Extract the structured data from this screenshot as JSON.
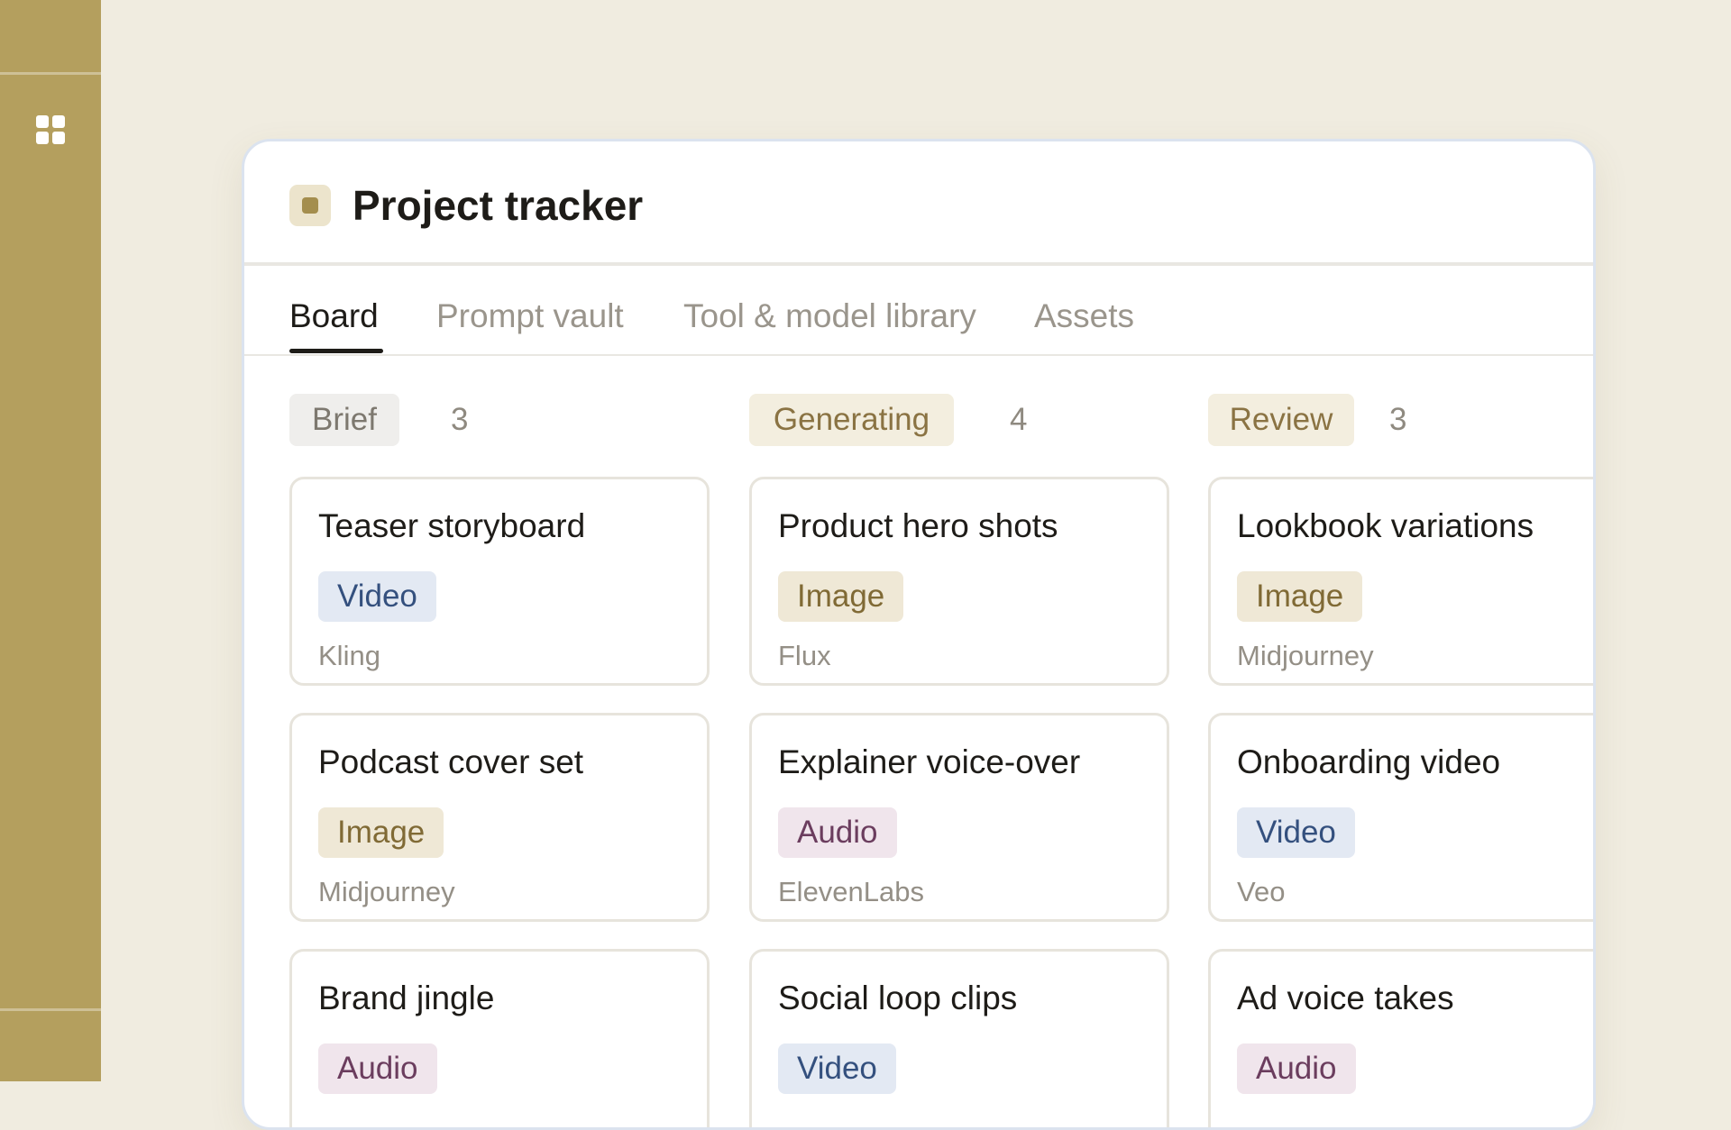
{
  "project": {
    "title": "Project tracker",
    "icon": "project-square-icon"
  },
  "tabs": [
    {
      "label": "Board",
      "active": true
    },
    {
      "label": "Prompt vault",
      "active": false
    },
    {
      "label": "Tool & model library",
      "active": false
    },
    {
      "label": "Assets",
      "active": false
    }
  ],
  "columns": [
    {
      "status": "Brief",
      "count": "3",
      "color": "#efeeec",
      "text_color": "#7d786f",
      "cards": [
        {
          "title": "Teaser storyboard",
          "tag": "Video",
          "tool": "Kling"
        },
        {
          "title": "Podcast cover set",
          "tag": "Image",
          "tool": "Midjourney"
        },
        {
          "title": "Brand jingle",
          "tag": "Audio",
          "tool": ""
        }
      ]
    },
    {
      "status": "Generating",
      "count": "4",
      "color": "#f3eedf",
      "text_color": "#8a7343",
      "cards": [
        {
          "title": "Product hero shots",
          "tag": "Image",
          "tool": "Flux"
        },
        {
          "title": "Explainer voice-over",
          "tag": "Audio",
          "tool": "ElevenLabs"
        },
        {
          "title": "Social loop clips",
          "tag": "Video",
          "tool": ""
        }
      ]
    },
    {
      "status": "Review",
      "count": "3",
      "color": "#f3eedf",
      "text_color": "#8a7343",
      "cards": [
        {
          "title": "Lookbook variations",
          "tag": "Image",
          "tool": "Midjourney"
        },
        {
          "title": "Onboarding video",
          "tag": "Video",
          "tool": "Veo"
        },
        {
          "title": "Ad voice takes",
          "tag": "Audio",
          "tool": ""
        }
      ]
    }
  ],
  "tag_colors": {
    "Video": "#e3e9f3",
    "Image": "#efe8d6",
    "Audio": "#f0e5ec"
  },
  "sidebar": {
    "icon": "grid-icon",
    "color": "#b49f5e"
  }
}
